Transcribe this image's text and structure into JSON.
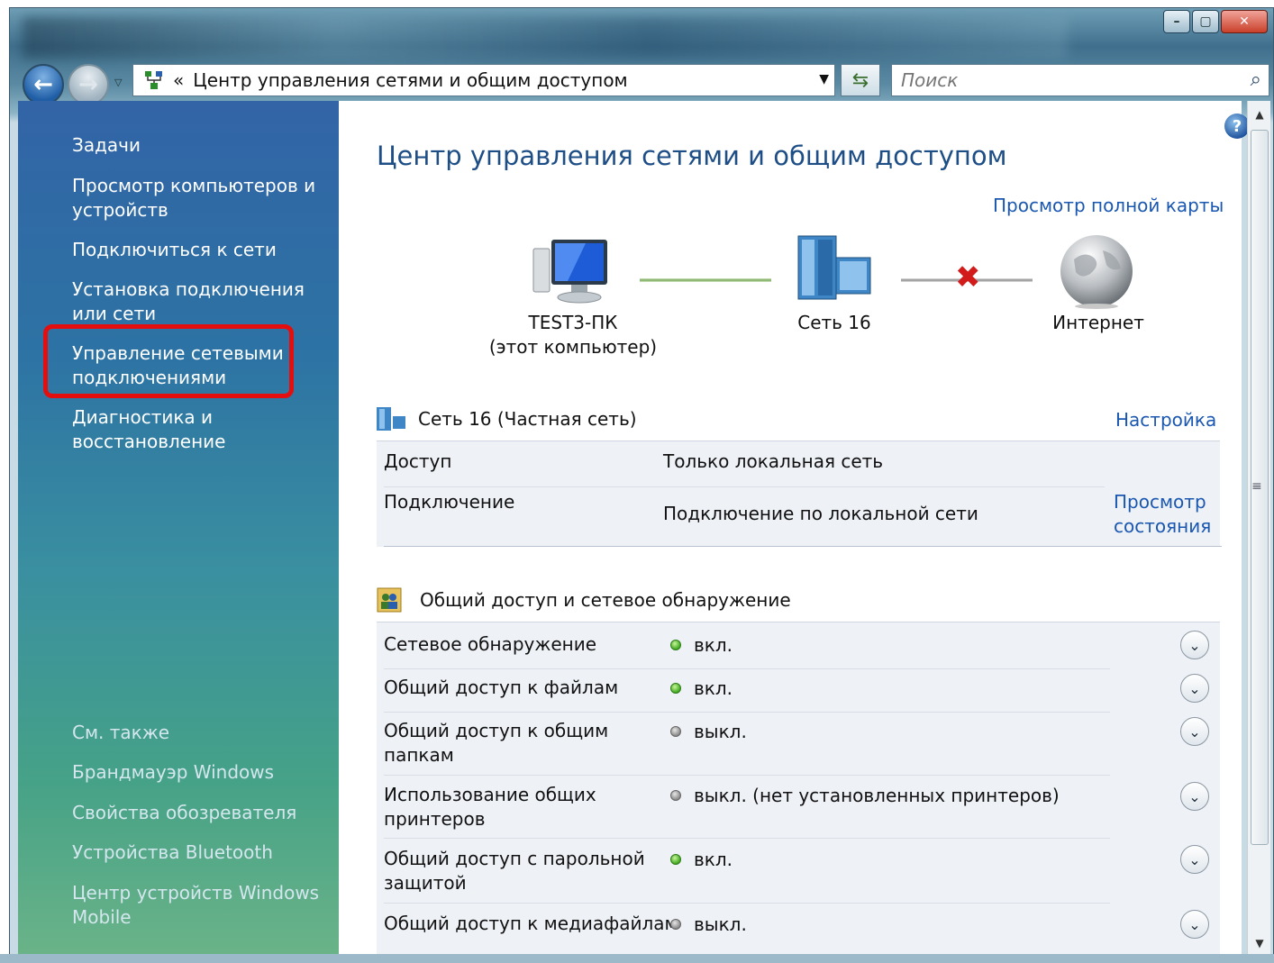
{
  "search": {
    "placeholder": "Поиск"
  },
  "address": {
    "path": "Центр управления сетями и общим доступом",
    "chevron": "«"
  },
  "sidebar": {
    "tasks_heading": "Задачи",
    "tasks": [
      "Просмотр компьютеров и устройств",
      "Подключиться к сети",
      "Установка подключения или сети",
      "Управление сетевыми подключениями",
      "Диагностика и восстановление"
    ],
    "see_also_heading": "См. также",
    "see_also": [
      "Брандмауэр Windows",
      "Свойства обозревателя",
      "Устройства Bluetooth",
      "Центр устройств Windows Mobile"
    ]
  },
  "main": {
    "title": "Центр управления сетями и общим доступом",
    "full_map_link": "Просмотр полной карты",
    "map": {
      "computer_name": "TEST3-ПК",
      "computer_sub": "(этот компьютер)",
      "network_name": "Сеть 16",
      "internet": "Интернет"
    },
    "network": {
      "title": "Сеть  16 (Частная сеть)",
      "customize_link": "Настройка",
      "access_label": "Доступ",
      "access_value": "Только локальная сеть",
      "connection_label": "Подключение",
      "connection_value": "Подключение по локальной сети",
      "status_link": "Просмотр состояния"
    },
    "sharing": {
      "title": "Общий доступ и сетевое обнаружение",
      "rows": [
        {
          "label": "Сетевое обнаружение",
          "status": "вкл.",
          "state": "on"
        },
        {
          "label": "Общий доступ к файлам",
          "status": "вкл.",
          "state": "on"
        },
        {
          "label": "Общий доступ к общим папкам",
          "status": "выкл.",
          "state": "off"
        },
        {
          "label": "Использование общих принтеров",
          "status": "выкл. (нет установленных принтеров)",
          "state": "off"
        },
        {
          "label": "Общий доступ с парольной защитой",
          "status": "вкл.",
          "state": "on"
        },
        {
          "label": "Общий доступ к медиафайлам",
          "status": "выкл.",
          "state": "off"
        }
      ]
    }
  },
  "colors": {
    "link": "#1a57b0",
    "title": "#1e4e86",
    "highlight": "#e50e0e",
    "status_on": "#3fa91f",
    "status_off": "#8a8a8a"
  }
}
